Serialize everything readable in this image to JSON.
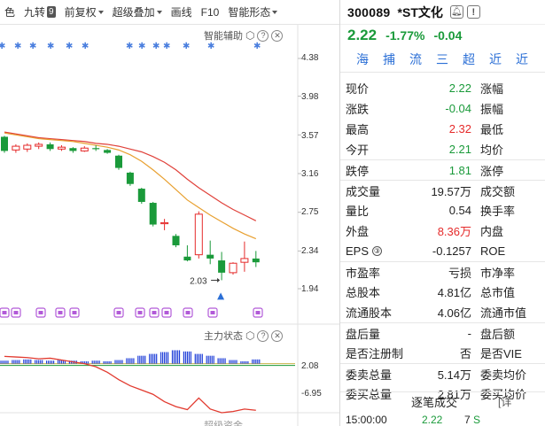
{
  "toolbar": {
    "items": [
      {
        "label": "色",
        "caret": false
      },
      {
        "label": "九转",
        "badge": "9"
      },
      {
        "label": "前复权",
        "caret": true
      },
      {
        "label": "超级叠加",
        "caret": true
      },
      {
        "label": "画线"
      },
      {
        "label": "F10"
      },
      {
        "label": "智能形态",
        "caret": true
      }
    ]
  },
  "main_chart": {
    "panel_title": "智能辅助",
    "y_ticks": [
      "4.38",
      "3.98",
      "3.57",
      "3.16",
      "2.75",
      "2.34",
      "1.94"
    ],
    "low_marker": "2.03",
    "signal_star": "✱"
  },
  "sub_chart": {
    "panel_title": "主力状态",
    "y_ticks": [
      "2.08",
      "-6.95"
    ],
    "bottom_label": "超级资金"
  },
  "chart_data": [
    {
      "type": "candlestick",
      "title": "",
      "ylim": [
        1.94,
        4.38
      ],
      "y_ticks": [
        4.38,
        3.98,
        3.57,
        3.16,
        2.75,
        2.34,
        1.94
      ],
      "candles": [
        {
          "o": 3.55,
          "h": 3.56,
          "l": 3.38,
          "c": 3.4
        },
        {
          "o": 3.41,
          "h": 3.47,
          "l": 3.38,
          "c": 3.45
        },
        {
          "o": 3.42,
          "h": 3.48,
          "l": 3.39,
          "c": 3.46
        },
        {
          "o": 3.45,
          "h": 3.49,
          "l": 3.42,
          "c": 3.47
        },
        {
          "o": 3.47,
          "h": 3.49,
          "l": 3.4,
          "c": 3.42
        },
        {
          "o": 3.42,
          "h": 3.46,
          "l": 3.4,
          "c": 3.44
        },
        {
          "o": 3.43,
          "h": 3.44,
          "l": 3.38,
          "c": 3.4
        },
        {
          "o": 3.4,
          "h": 3.45,
          "l": 3.39,
          "c": 3.43
        },
        {
          "o": 3.43,
          "h": 3.46,
          "l": 3.4,
          "c": 3.42
        },
        {
          "o": 3.41,
          "h": 3.42,
          "l": 3.37,
          "c": 3.38
        },
        {
          "o": 3.35,
          "h": 3.36,
          "l": 3.2,
          "c": 3.22
        },
        {
          "o": 3.17,
          "h": 3.18,
          "l": 3.03,
          "c": 3.05
        },
        {
          "o": 3.0,
          "h": 3.01,
          "l": 2.84,
          "c": 2.86
        },
        {
          "o": 2.85,
          "h": 2.86,
          "l": 2.6,
          "c": 2.62
        },
        {
          "o": 2.63,
          "h": 2.68,
          "l": 2.56,
          "c": 2.64
        },
        {
          "o": 2.5,
          "h": 2.52,
          "l": 2.38,
          "c": 2.4
        },
        {
          "o": 2.28,
          "h": 2.4,
          "l": 2.23,
          "c": 2.24
        },
        {
          "o": 2.3,
          "h": 2.76,
          "l": 2.26,
          "c": 2.73
        },
        {
          "o": 2.3,
          "h": 2.45,
          "l": 2.2,
          "c": 2.26
        },
        {
          "o": 2.24,
          "h": 2.33,
          "l": 2.03,
          "c": 2.11
        },
        {
          "o": 2.11,
          "h": 2.22,
          "l": 2.09,
          "c": 2.21
        },
        {
          "o": 2.22,
          "h": 2.44,
          "l": 2.12,
          "c": 2.26
        },
        {
          "o": 2.26,
          "h": 2.34,
          "l": 2.17,
          "c": 2.22
        }
      ],
      "ma_red": [
        3.6,
        3.58,
        3.56,
        3.54,
        3.53,
        3.52,
        3.51,
        3.5,
        3.48,
        3.47,
        3.45,
        3.42,
        3.39,
        3.34,
        3.28,
        3.2,
        3.1,
        3.01,
        2.93,
        2.85,
        2.78,
        2.72,
        2.66
      ],
      "ma_orange": [
        3.59,
        3.57,
        3.55,
        3.53,
        3.52,
        3.51,
        3.5,
        3.48,
        3.46,
        3.44,
        3.41,
        3.36,
        3.29,
        3.2,
        3.1,
        2.99,
        2.88,
        2.8,
        2.72,
        2.65,
        2.58,
        2.52,
        2.47
      ]
    },
    {
      "type": "bar",
      "title": "",
      "ylim": [
        -8,
        4
      ],
      "y_ticks": [
        2.08,
        -6.95
      ],
      "bars": [
        0.5,
        0.6,
        0.7,
        0.6,
        0.5,
        0.6,
        0.5,
        0.4,
        0.5,
        0.4,
        0.6,
        0.9,
        1.3,
        1.6,
        1.9,
        2.2,
        2.0,
        1.6,
        1.3,
        0.9,
        0.6,
        0.4,
        0.7
      ],
      "line": [
        1.2,
        1.1,
        1.0,
        0.8,
        0.9,
        0.6,
        0.3,
        0.0,
        -0.5,
        -1.4,
        -2.6,
        -3.6,
        -4.3,
        -5.0,
        -6.2,
        -7.0,
        -7.5,
        -5.6,
        -7.4,
        -8.0,
        -7.8,
        -7.4,
        -7.6
      ]
    }
  ],
  "quote": {
    "code": "300089",
    "name": "*ST文化",
    "price": "2.22",
    "pct": "-1.77%",
    "change": "-0.04",
    "buttons": [
      "海",
      "捕",
      "流",
      "三",
      "超",
      "近",
      "近"
    ],
    "rows": [
      {
        "l": "现价",
        "v": "2.22",
        "c": "green",
        "r": "涨幅"
      },
      {
        "l": "涨跌",
        "v": "-0.04",
        "c": "green",
        "r": "振幅"
      },
      {
        "l": "最高",
        "v": "2.32",
        "c": "red",
        "r": "最低"
      },
      {
        "l": "今开",
        "v": "2.21",
        "c": "green",
        "r": "均价"
      },
      {
        "l": "跌停",
        "v": "1.81",
        "c": "green",
        "r": "涨停",
        "sep": true
      },
      {
        "l": "成交量",
        "v": "19.57万",
        "c": "dark",
        "r": "成交额",
        "sep": true
      },
      {
        "l": "量比",
        "v": "0.54",
        "c": "dark",
        "r": "换手率"
      },
      {
        "l": "外盘",
        "v": "8.36万",
        "c": "red",
        "r": "内盘"
      },
      {
        "l": "EPS",
        "v": "-0.1257",
        "c": "dark",
        "r": "ROE",
        "info": "③"
      },
      {
        "l": "市盈率",
        "v": "亏损",
        "c": "dark",
        "r": "市净率",
        "sep": true
      },
      {
        "l": "总股本",
        "v": "4.81亿",
        "c": "dark",
        "r": "总市值"
      },
      {
        "l": "流通股本",
        "v": "4.06亿",
        "c": "dark",
        "r": "流通市值"
      },
      {
        "l": "盘后量",
        "v": "-",
        "c": "dark",
        "r": "盘后额",
        "sep": true
      },
      {
        "l": "是否注册制",
        "v": "否",
        "c": "dark",
        "r": "是否VIE"
      },
      {
        "l": "委卖总量",
        "v": "5.14万",
        "c": "dark",
        "r": "委卖均价",
        "sep": true
      },
      {
        "l": "委买总量",
        "v": "2.81万",
        "c": "dark",
        "r": "委买均价"
      }
    ],
    "trades_title": "逐笔成交",
    "trades_more": "[详",
    "trade_row": {
      "time": "15:00:00",
      "price": "2.22",
      "vol": "7",
      "flag": "S"
    }
  },
  "colors": {
    "up": "#e52a2a",
    "down": "#1a9a3a",
    "ma_red": "#e0413a",
    "ma_orange": "#e8a030",
    "bar_blue": "#1f3fd8",
    "accent": "#2b6fd6"
  }
}
